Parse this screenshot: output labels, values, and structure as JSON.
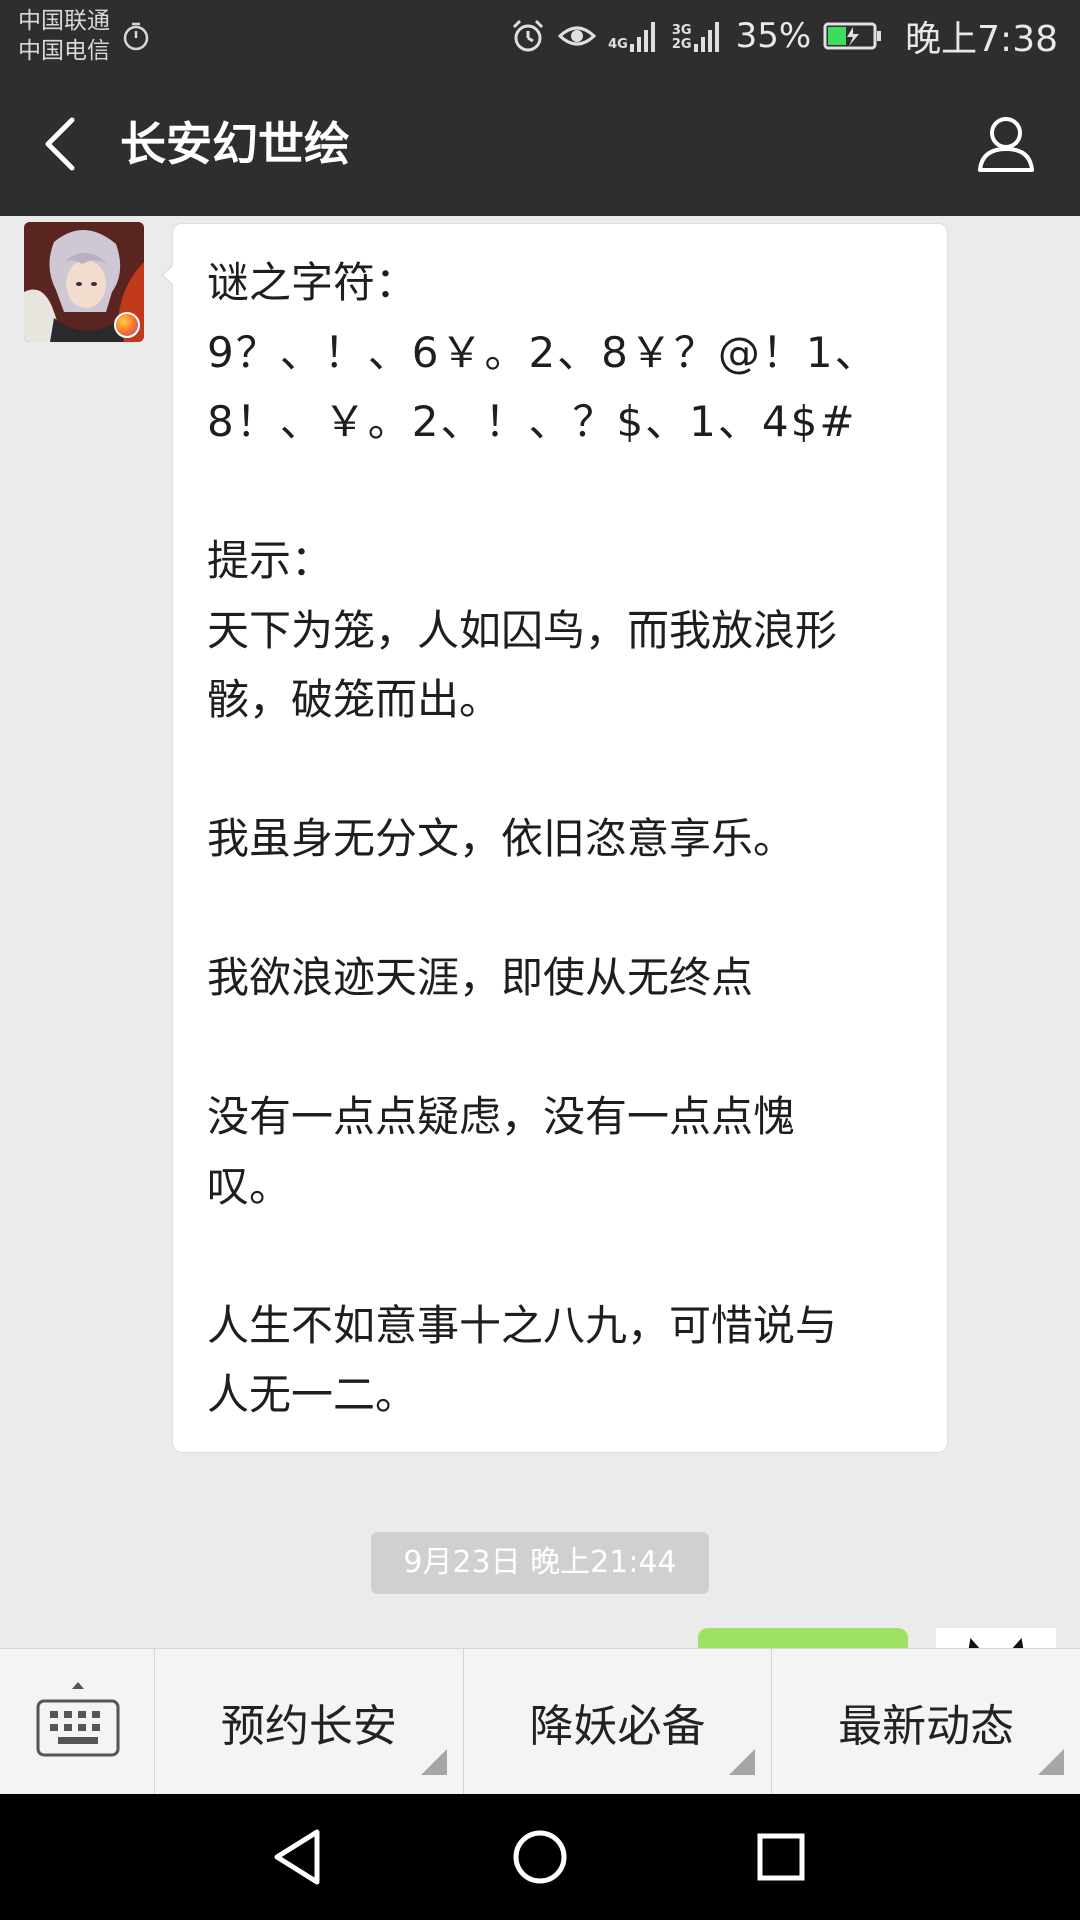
{
  "status_bar": {
    "carrier1": "中国联通",
    "carrier2": "中国电信",
    "net1": "4G",
    "net2a": "3G",
    "net2b": "2G",
    "battery": "35%",
    "time": "晚上7:38",
    "icons": [
      "timer-icon",
      "alarm-icon",
      "eye-icon",
      "signal-icon",
      "battery-icon"
    ]
  },
  "header": {
    "title": "长安幻世绘"
  },
  "message": {
    "lines": [
      "谜之字符：",
      "9？、！、6￥。2、8￥？@！1、",
      "8！、￥。2、！、？$、1、4$#",
      "",
      "提示：",
      "天下为笼，人如囚鸟，而我放浪形",
      "骸，破笼而出。",
      "",
      "我虽身无分文，依旧恣意享乐。",
      "",
      "我欲浪迹天涯，即使从无终点",
      "",
      "没有一点点疑虑，没有一点点愧",
      "叹。",
      "",
      "人生不如意事十之八九，可惜说与",
      "人无一二。"
    ]
  },
  "timestamp": "9月23日 晚上21:44",
  "menu": {
    "items": [
      "预约长安",
      "降妖必备",
      "最新动态"
    ]
  },
  "colors": {
    "header_bg": "#2e2e2e",
    "chat_bg": "#ebebeb",
    "sent_bubble": "#9ee264"
  }
}
